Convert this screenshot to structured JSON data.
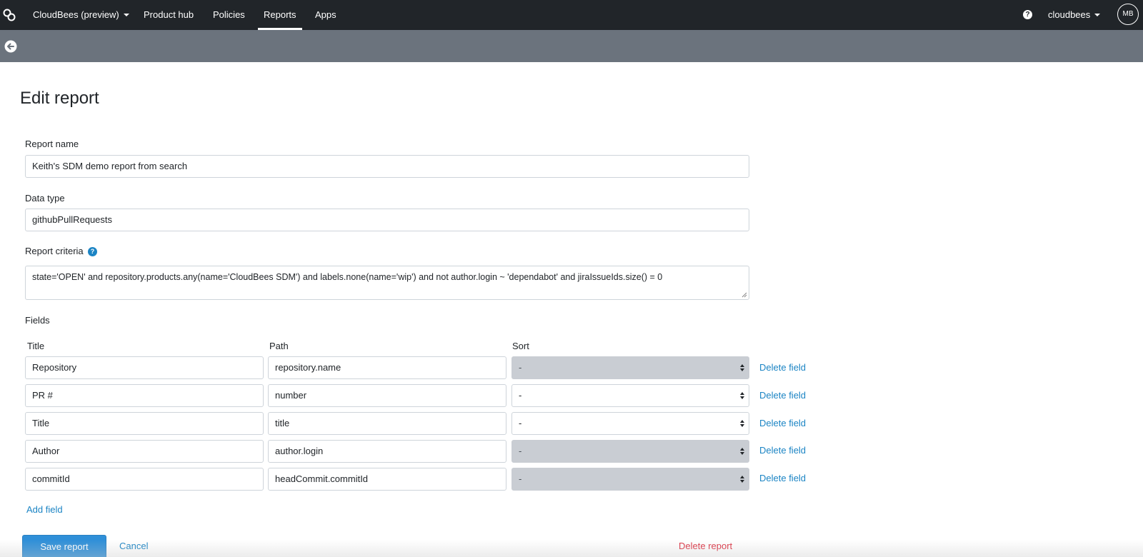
{
  "nav": {
    "org_switcher": "CloudBees (preview)",
    "items": [
      "Product hub",
      "Policies",
      "Reports",
      "Apps"
    ],
    "active": "Reports",
    "account": "cloudbees",
    "avatar_initials": "MB",
    "help_symbol": "?"
  },
  "page": {
    "title": "Edit report"
  },
  "form": {
    "report_name_label": "Report name",
    "report_name_value": "Keith's SDM demo report from search",
    "data_type_label": "Data type",
    "data_type_value": "githubPullRequests",
    "criteria_label": "Report criteria",
    "criteria_value": "state='OPEN' and repository.products.any(name='CloudBees SDM') and labels.none(name='wip') and not author.login ~ 'dependabot' and jiraIssueIds.size() = 0",
    "fields_label": "Fields",
    "columns": {
      "title": "Title",
      "path": "Path",
      "sort": "Sort"
    },
    "delete_field_label": "Delete field",
    "fields": [
      {
        "title": "Repository",
        "path": "repository.name",
        "sort": "-",
        "sort_disabled": true
      },
      {
        "title": "PR #",
        "path": "number",
        "sort": "-",
        "sort_disabled": false
      },
      {
        "title": "Title",
        "path": "title",
        "sort": "-",
        "sort_disabled": false
      },
      {
        "title": "Author",
        "path": "author.login",
        "sort": "-",
        "sort_disabled": true
      },
      {
        "title": "commitId",
        "path": "headCommit.commitId",
        "sort": "-",
        "sort_disabled": true
      }
    ],
    "add_field_label": "Add field"
  },
  "actions": {
    "save": "Save report",
    "cancel": "Cancel",
    "delete": "Delete report"
  },
  "colors": {
    "nav_bg": "#212529",
    "subbar_bg": "#6b737d",
    "link": "#1b84c4",
    "primary": "#2f8fd8",
    "danger": "#dc3545",
    "disabled_select": "#c9cdd3"
  },
  "icons": {
    "logo": "cloudbees-logo-icon",
    "help": "help-circle-icon",
    "back": "arrow-left-circle-icon",
    "criteria_help": "question-circle-icon",
    "select_arrows": "updown-arrows-icon",
    "caret": "caret-down-icon"
  }
}
